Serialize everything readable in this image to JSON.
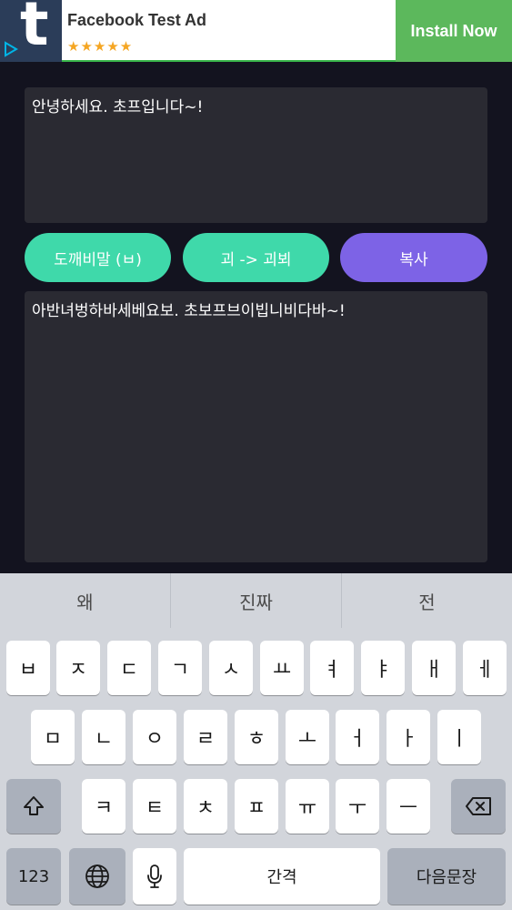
{
  "ad": {
    "title": "Facebook Test Ad",
    "stars": "★★★★★",
    "install_label": "Install Now",
    "logo_letter": "t",
    "colors": {
      "install_bg": "#5cb85c",
      "logo_bg": "#2b3d59",
      "stars": "#f5a623"
    }
  },
  "input_text": "안녕하세요. 초프입니다~!",
  "buttons": {
    "dokkaebi": "도깨비말 (ㅂ)",
    "convert": "괴 -> 괴뵈",
    "copy": "복사"
  },
  "output_text": "아반녀벙하바세베요보. 초보프브이빕니비다바~!",
  "colors": {
    "green": "#3fd9aa",
    "purple": "#7d63e6",
    "background": "#13131f",
    "textbox": "#2a2a32"
  },
  "keyboard": {
    "suggestions": [
      "왜",
      "진짜",
      "전"
    ],
    "row1": [
      "ㅂ",
      "ㅈ",
      "ㄷ",
      "ㄱ",
      "ㅅ",
      "ㅛ",
      "ㅕ",
      "ㅑ",
      "ㅐ",
      "ㅔ"
    ],
    "row2": [
      "ㅁ",
      "ㄴ",
      "ㅇ",
      "ㄹ",
      "ㅎ",
      "ㅗ",
      "ㅓ",
      "ㅏ",
      "ㅣ"
    ],
    "row3": [
      "ㅋ",
      "ㅌ",
      "ㅊ",
      "ㅍ",
      "ㅠ",
      "ㅜ",
      "ㅡ"
    ],
    "numbers_label": "123",
    "space_label": "간격",
    "return_label": "다음문장",
    "icons": {
      "shift": "shift-icon",
      "backspace": "backspace-icon",
      "globe": "globe-icon",
      "mic": "microphone-icon"
    }
  }
}
